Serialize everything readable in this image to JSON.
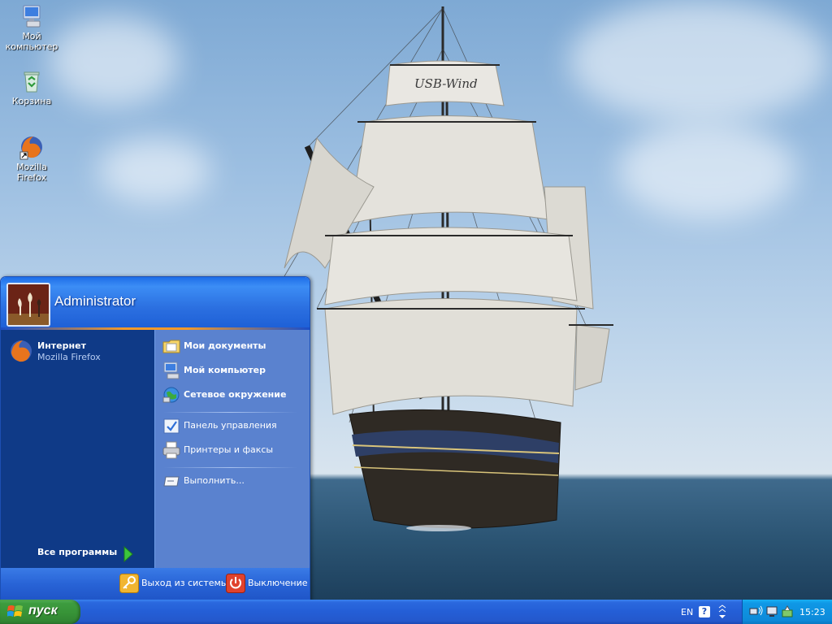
{
  "desktop": {
    "icons": [
      {
        "label": "Мой компьютер",
        "icon": "my-computer-icon"
      },
      {
        "label": "Корзина",
        "icon": "recycle-bin-icon"
      },
      {
        "label": "Mozilla Firefox",
        "icon": "firefox-shortcut-icon"
      }
    ],
    "wallpaper_text": "USB-Wind"
  },
  "start_menu": {
    "user_name": "Administrator",
    "pinned": [
      {
        "title": "Интернет",
        "subtitle": "Mozilla Firefox",
        "icon": "firefox-icon"
      }
    ],
    "all_programs_label": "Все программы",
    "right_items": [
      {
        "label": "Мои документы",
        "icon": "my-documents-icon",
        "bold": true
      },
      {
        "label": "Мой компьютер",
        "icon": "my-computer-icon",
        "bold": true
      },
      {
        "label": "Сетевое окружение",
        "icon": "network-places-icon",
        "bold": true
      },
      {
        "label": "Панель управления",
        "icon": "control-panel-icon",
        "bold": false
      },
      {
        "label": "Принтеры и факсы",
        "icon": "printers-icon",
        "bold": false
      },
      {
        "label": "Выполнить...",
        "icon": "run-icon",
        "bold": false
      }
    ],
    "logoff_label": "Выход из системы",
    "shutdown_label": "Выключение"
  },
  "taskbar": {
    "start_label": "пуск",
    "language": "EN",
    "help_glyph": "?",
    "clock": "15:23"
  },
  "colors": {
    "taskbar_blue": "#245ed6",
    "start_green": "#379337",
    "menu_left": "#0f3a87",
    "menu_right": "#5a82cf",
    "tray_blue": "#0d8ad9"
  }
}
